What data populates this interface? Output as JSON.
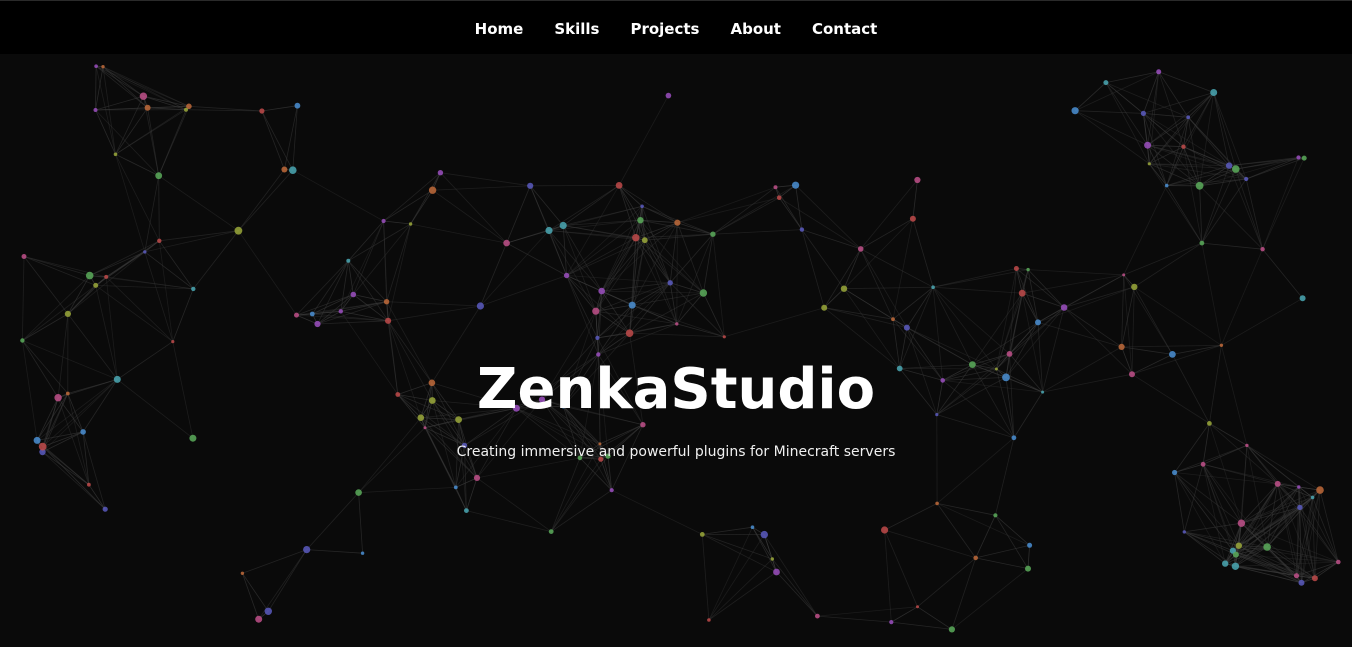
{
  "nav": {
    "items": [
      {
        "label": "Home"
      },
      {
        "label": "Skills"
      },
      {
        "label": "Projects"
      },
      {
        "label": "About"
      },
      {
        "label": "Contact"
      }
    ]
  },
  "hero": {
    "title": "ZenkaStudio",
    "subtitle": "Creating immersive and powerful plugins for Minecraft servers"
  },
  "colors": {
    "background": "#0a0a0a",
    "navbar": "#000000",
    "text": "#ffffff",
    "link_line": "#3a3a3a",
    "node_palette": [
      "#4a8fd4",
      "#9b4fc0",
      "#c0508a",
      "#5aab5a",
      "#9aa83a",
      "#c06a3a",
      "#4aa8b4",
      "#5a5ac0",
      "#c04a4a"
    ]
  }
}
